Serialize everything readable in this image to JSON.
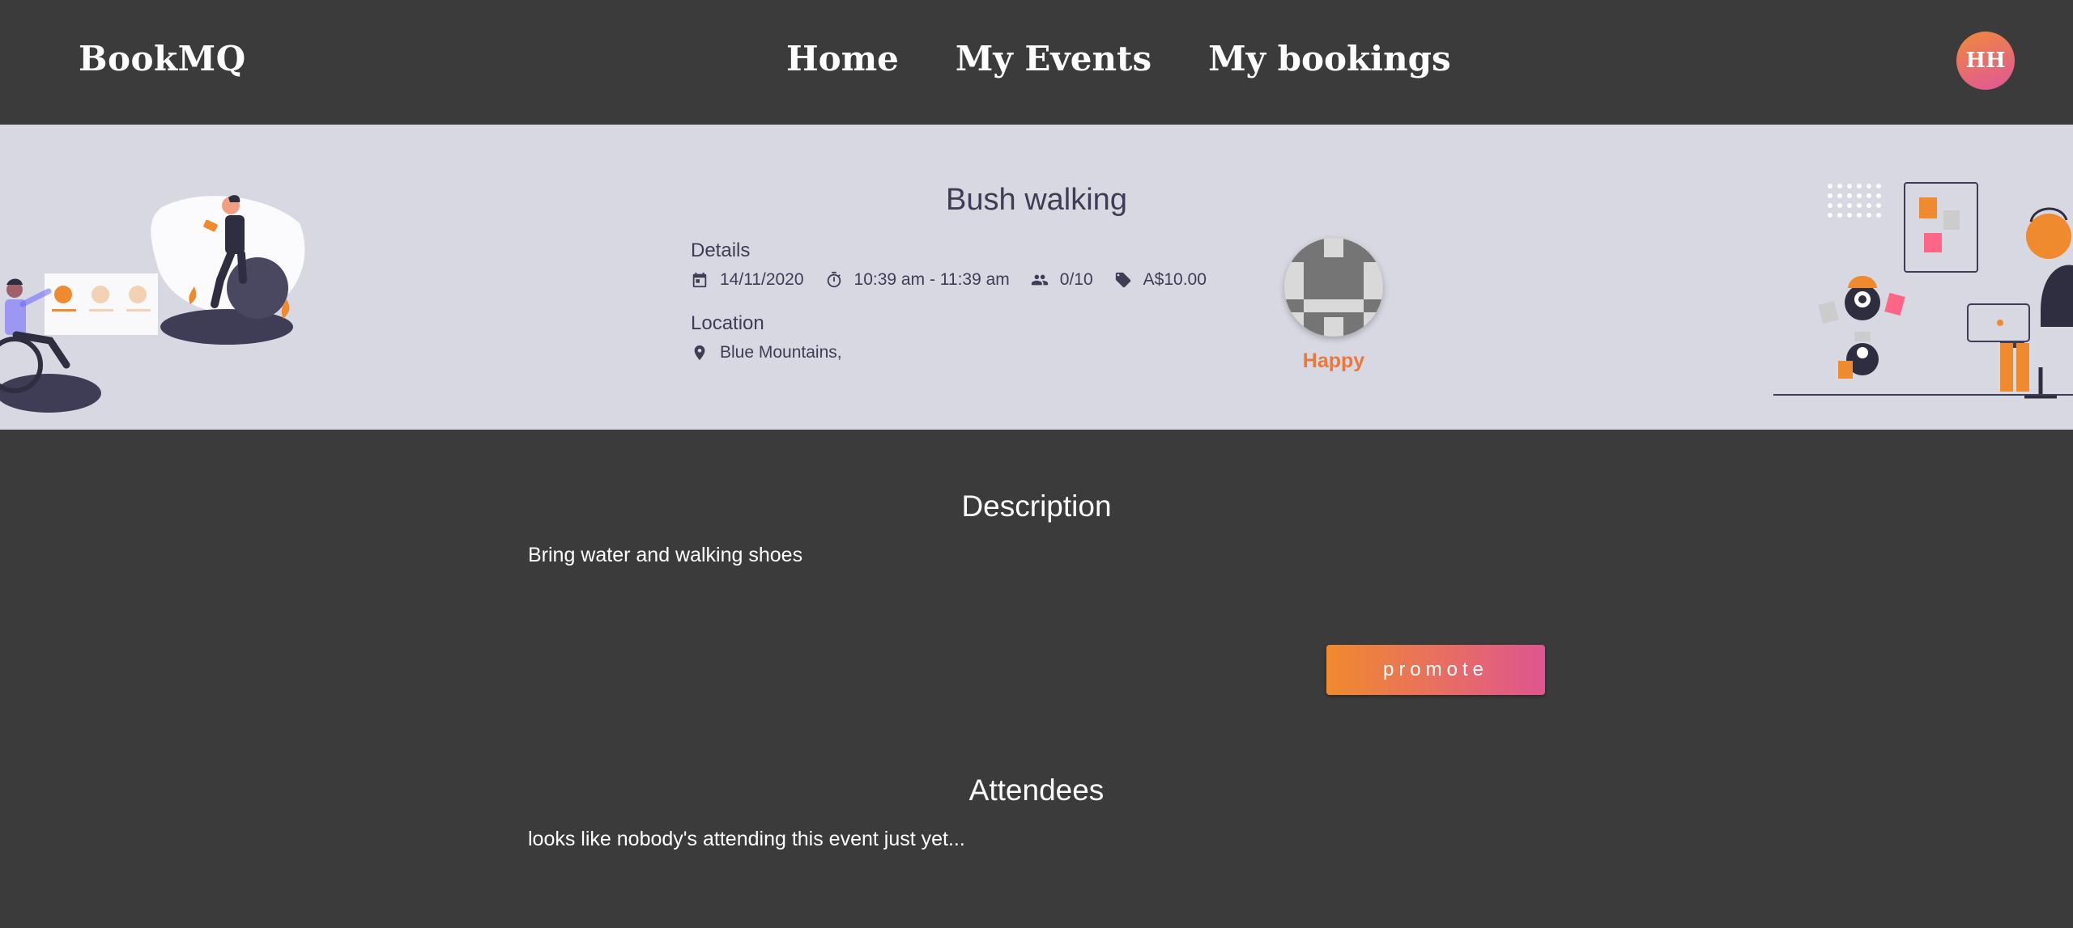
{
  "nav": {
    "brand": "BookMQ",
    "links": [
      "Home",
      "My Events",
      "My bookings"
    ],
    "avatar_initials": "HH"
  },
  "event": {
    "title": "Bush walking",
    "details_label": "Details",
    "date": "14/11/2020",
    "time": "10:39 am - 11:39 am",
    "capacity": "0/10",
    "price": "A$10.00",
    "location_label": "Location",
    "location": "Blue Mountains,",
    "host_name": "Happy",
    "icons": [
      "calendar-icon",
      "stopwatch-icon",
      "people-icon",
      "price-tag-icon",
      "location-pin-icon"
    ]
  },
  "description": {
    "title": "Description",
    "text": "Bring water and walking shoes",
    "promote_label": "promote"
  },
  "attendees": {
    "title": "Attendees",
    "empty_text": "looks like nobody's attending this event just yet..."
  },
  "colors": {
    "background": "#3b3b3b",
    "hero_background": "#d8d8e3",
    "text_dark": "#3f3d56",
    "accent_orange": "#f08a2e",
    "accent_pink": "#df5590"
  }
}
